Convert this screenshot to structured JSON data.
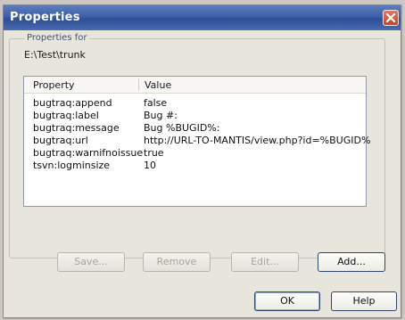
{
  "dialog": {
    "title": "Properties",
    "group_label": "Properties for",
    "path": "E:\\Test\\trunk"
  },
  "columns": {
    "property": "Property",
    "value": "Value"
  },
  "rows": [
    {
      "property": "bugtraq:append",
      "value": "false"
    },
    {
      "property": "bugtraq:label",
      "value": "Bug #:"
    },
    {
      "property": "bugtraq:message",
      "value": "Bug %BUGID%:"
    },
    {
      "property": "bugtraq:url",
      "value": "http://URL-TO-MANTIS/view.php?id=%BUGID%"
    },
    {
      "property": "bugtraq:warnifnoissue",
      "value": "true"
    },
    {
      "property": "tsvn:logminsize",
      "value": "10"
    }
  ],
  "buttons": {
    "save": "Save...",
    "remove": "Remove",
    "edit": "Edit...",
    "add": "Add...",
    "ok": "OK",
    "help": "Help"
  },
  "icons": {
    "close": "close-icon"
  },
  "colors": {
    "titlebar": "#3b5fa8",
    "close": "#c2462b",
    "dialog_bg": "#e8e5dc"
  }
}
